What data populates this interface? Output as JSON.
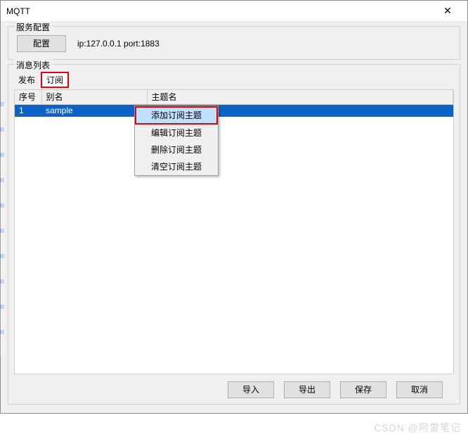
{
  "window": {
    "title": "MQTT",
    "close": "✕"
  },
  "service": {
    "legend": "服务配置",
    "config_btn": "配置",
    "ip_label": "ip:127.0.0.1 port:1883"
  },
  "messages": {
    "legend": "消息列表",
    "tab_publish": "发布",
    "tab_subscribe": "订阅",
    "columns": {
      "seq": "序号",
      "alias": "别名",
      "topic": "主题名"
    },
    "rows": [
      {
        "seq": "1",
        "alias": "sample",
        "topic": ""
      }
    ]
  },
  "context_menu": {
    "add": "添加订阅主题",
    "edit": "编辑订阅主题",
    "delete": "删除订阅主题",
    "clear": "清空订阅主题"
  },
  "footer": {
    "import": "导入",
    "export": "导出",
    "save": "保存",
    "cancel": "取消"
  },
  "watermark": "CSDN @阿雷笔记"
}
